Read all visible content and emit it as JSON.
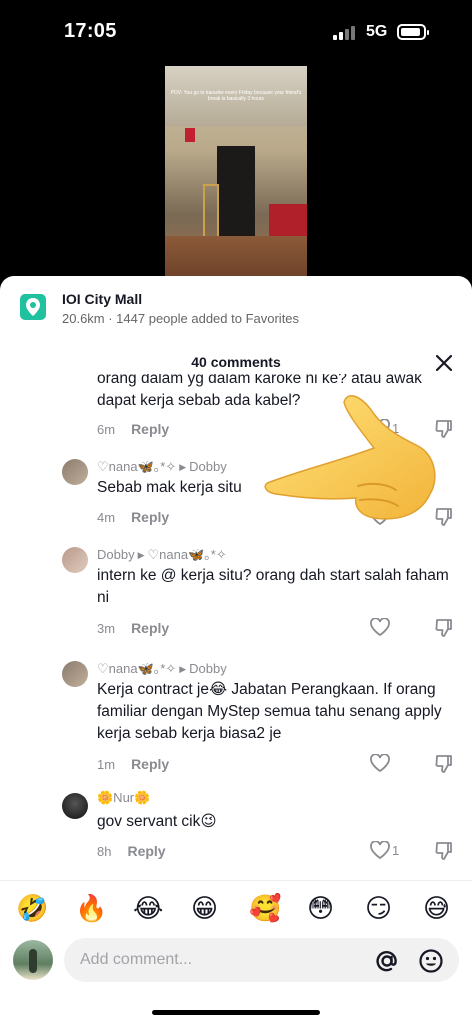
{
  "status_bar": {
    "time": "17:05",
    "network": "5G"
  },
  "video": {
    "caption": "POV: You go to karaoke every Friday because your friend's break is basically 3 hours"
  },
  "location": {
    "title": "IOI City Mall",
    "subtitle": "20.6km · 1447 people added to Favorites",
    "icon": "location-pin-icon",
    "color": "#20c19e"
  },
  "comments_header": {
    "count_label": "40 comments"
  },
  "comments": [
    {
      "text": "orang dalam yg dalam karoke ni ke? atau awak dapat kerja sebab ada kabel?",
      "time": "6m",
      "reply_label": "Reply",
      "likes": "1"
    },
    {
      "user": "♡nana🦋｡*✧",
      "reply_to": "Dobby",
      "text": "Sebab mak kerja situ",
      "time": "4m",
      "reply_label": "Reply",
      "likes": ""
    },
    {
      "user": "Dobby",
      "reply_to": "♡nana🦋｡*✧",
      "text": "intern ke @ kerja situ? orang dah start salah faham ni",
      "time": "3m",
      "reply_label": "Reply",
      "likes": ""
    },
    {
      "user": "♡nana🦋｡*✧",
      "reply_to": "Dobby",
      "text": "Kerja contract je😂 Jabatan Perangkaan. If orang familiar dengan MyStep semua tahu senang apply kerja sebab kerja biasa2 je",
      "time": "1m",
      "reply_label": "Reply",
      "likes": ""
    },
    {
      "user": "🌼Nur🌼",
      "text": "gov servant cik😉",
      "time": "8h",
      "reply_label": "Reply",
      "likes": "1"
    }
  ],
  "emoji_bar": [
    "🤣",
    "🔥",
    "😂",
    "😁",
    "🥰",
    "😳",
    "😏",
    "😅"
  ],
  "input": {
    "placeholder": "Add comment..."
  }
}
